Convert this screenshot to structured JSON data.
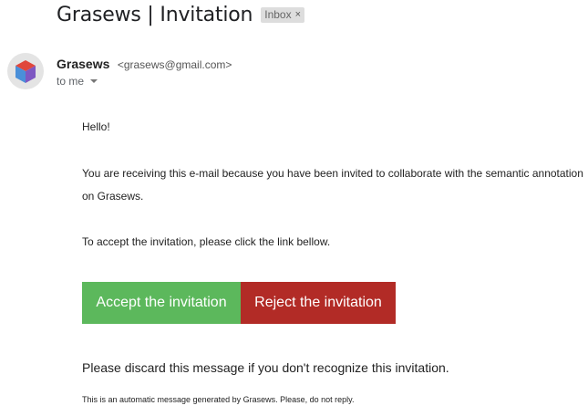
{
  "email": {
    "subject": "Grasews | Invitation",
    "label": "Inbox",
    "label_remove": "×",
    "sender_name": "Grasews",
    "sender_email": "<grasews@gmail.com>",
    "recipient": "to me"
  },
  "message": {
    "greeting": "Hello!",
    "line1": "You are receiving this e-mail because you have been invited to collaborate with the semantic annotation",
    "line2": "on Grasews.",
    "instruction": "To accept the invitation, please click the link bellow.",
    "accept_label": "Accept the invitation",
    "reject_label": "Reject the invitation",
    "discard_note": "Please discard this message if you don't recognize this invitation.",
    "footer": "This is an automatic message generated by Grasews. Please, do not reply."
  },
  "colors": {
    "accept": "#5cb85c",
    "reject": "#b22b26"
  },
  "icons": {
    "avatar": "cube-avatar-icon",
    "recipient_details": "chevron-down-icon",
    "label_remove": "close-icon"
  }
}
